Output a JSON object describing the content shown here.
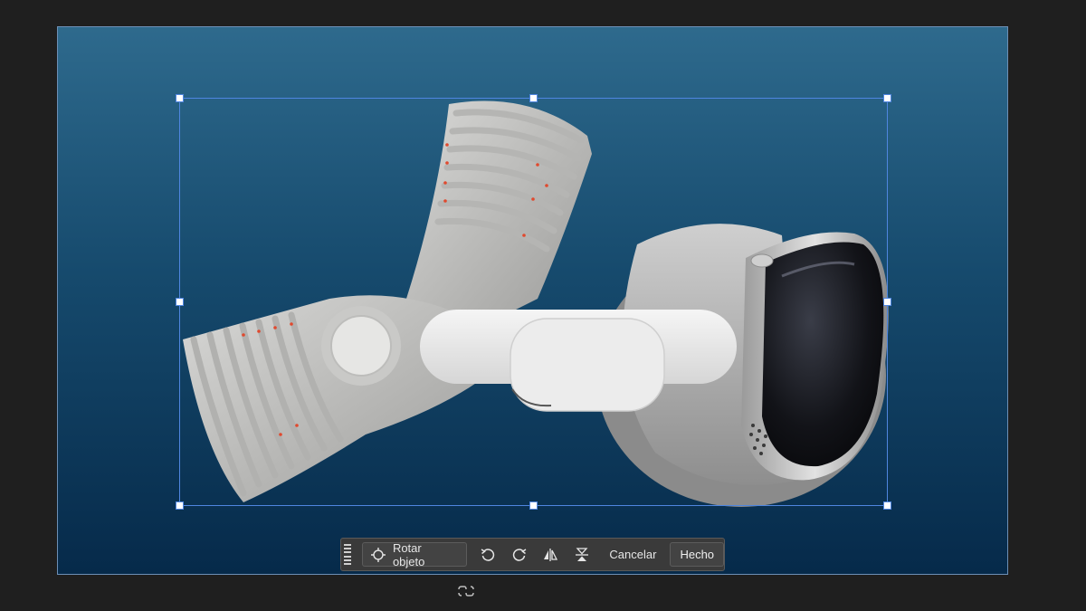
{
  "toolbar": {
    "rotate_label": "Rotar objeto",
    "cancel_label": "Cancelar",
    "done_label": "Hecho",
    "icons": [
      "grip-icon",
      "rotate-object-icon",
      "rotate-left-icon",
      "rotate-right-icon",
      "flip-horizontal-icon",
      "flip-vertical-icon"
    ]
  },
  "canvas": {
    "background_top": "#2e6a8d",
    "background_bottom": "#062a4a",
    "selection_color": "#4f86e0",
    "object": "vision-pro-headset-image"
  },
  "footer": {
    "icons": [
      "link-icon"
    ]
  }
}
